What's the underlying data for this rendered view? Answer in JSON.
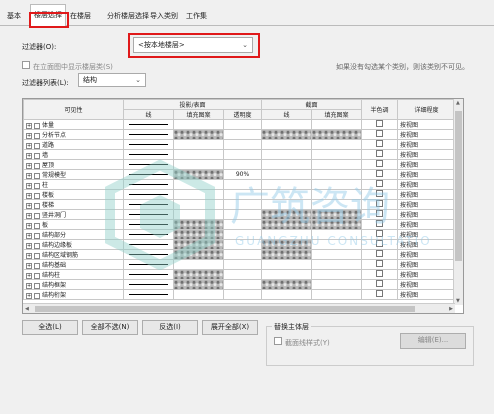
{
  "tabs": [
    "基本",
    "楼层选择",
    "在楼层",
    "分析楼层选择",
    "导入类别",
    "工作集"
  ],
  "filter": {
    "label": "过滤器(O):",
    "value": "<按本地楼层>",
    "show_label": "在立面图中显示楼层类(S)",
    "right_note": "如果没有勾选某个类别，则该类别不可见。",
    "list_label": "过滤器列表(L):",
    "list_value": "结构"
  },
  "table": {
    "headers": {
      "visibility": "可见性",
      "projection": "投影/表面",
      "cut": "截面",
      "halftone": "半色调",
      "detail": "详细程度",
      "lines": "线",
      "fill": "填充图案",
      "transparency": "透明度",
      "cut_lines": "线",
      "cut_fill": "填充图案"
    },
    "rows": [
      {
        "name": "体量",
        "detail": "按视图"
      },
      {
        "name": "分析节点",
        "detail": "按视图"
      },
      {
        "name": "道路",
        "detail": "按视图"
      },
      {
        "name": "墙",
        "detail": "按视图"
      },
      {
        "name": "屋顶",
        "detail": "按视图"
      },
      {
        "name": "常规模型",
        "detail": "按视图",
        "transparency": "90%"
      },
      {
        "name": "柱",
        "detail": "按视图"
      },
      {
        "name": "楼板",
        "detail": "按视图"
      },
      {
        "name": "楼梯",
        "detail": "按视图"
      },
      {
        "name": "竖井洞门",
        "detail": "按视图"
      },
      {
        "name": "板",
        "detail": "按视图"
      },
      {
        "name": "结构部分",
        "detail": "按视图"
      },
      {
        "name": "结构边缘板",
        "detail": "按视图"
      },
      {
        "name": "结构区域钢筋",
        "detail": "按视图"
      },
      {
        "name": "结构基础",
        "detail": "按视图"
      },
      {
        "name": "结构柱",
        "detail": "按视图"
      },
      {
        "name": "结构框架",
        "detail": "按视图"
      },
      {
        "name": "结构桁架",
        "detail": "按视图"
      }
    ]
  },
  "buttons": {
    "all": "全选(L)",
    "none": "全部不选(N)",
    "invert": "反选(I)",
    "expand": "展开全部(X)",
    "edit": "编辑(E)..."
  },
  "override": {
    "title": "替换主体层",
    "checkbox": "截面线样式(Y)"
  },
  "watermark": {
    "cn": "广筑咨询",
    "en": "GUANGZHU CONSULTATION"
  }
}
